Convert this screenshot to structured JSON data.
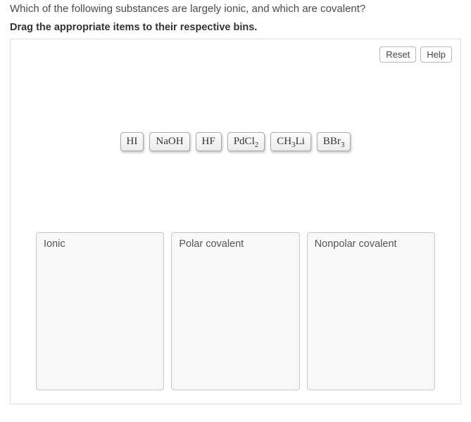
{
  "question": "Which of the following substances are largely ionic, and which are covalent?",
  "instruction": "Drag the appropriate items to their respective bins.",
  "toolbar": {
    "reset": "Reset",
    "help": "Help"
  },
  "items": {
    "i0": "HI",
    "i1": "NaOH",
    "i2": "HF",
    "i3": "PdCl",
    "i3_sub": "2",
    "i4_a": "CH",
    "i4_sub": "3",
    "i4_b": "Li",
    "i5": "BBr",
    "i5_sub": "3"
  },
  "bins": {
    "b0": "Ionic",
    "b1": "Polar covalent",
    "b2": "Nonpolar covalent"
  }
}
